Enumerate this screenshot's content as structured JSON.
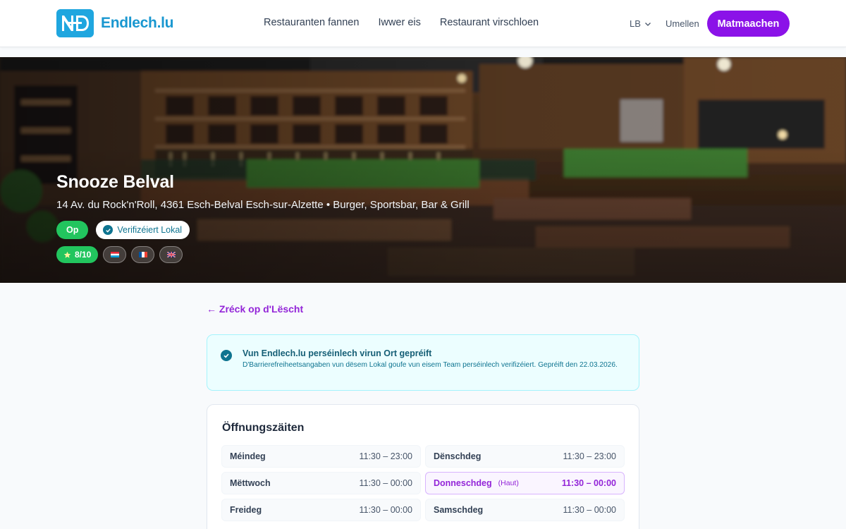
{
  "header": {
    "brand": "Endlech.lu",
    "nav": [
      "Restauranten fannen",
      "Iwwer eis",
      "Restaurant virschloen"
    ],
    "language": "LB",
    "login": "Umellen",
    "cta": "Matmaachen"
  },
  "hero": {
    "name": "Snooze Belval",
    "address": "14 Av. du Rock'n'Roll, 4361 Esch-Belval Esch-sur-Alzette",
    "categories": "Burger, Sportsbar, Bar & Grill",
    "status": "Op",
    "verified": "Verifizéiert Lokal",
    "rating": "8/10",
    "languages_shown": [
      "lb-flag-icon",
      "fr-flag-icon",
      "gb-flag-icon"
    ]
  },
  "back_link": "← Zréck op d'Lëscht",
  "notice": {
    "title": "Vun Endlech.lu perséinlech virun Ort gepréift",
    "text": "D'Barrierefreiheetsangaben vun dësem Lokal goufe vun eisem Team perséinlech verifizéiert. Gepréift den 22.03.2026."
  },
  "hours": {
    "title": "Öffnungszäiten",
    "days": [
      {
        "day": "Méindeg",
        "time": "11:30 – 23:00"
      },
      {
        "day": "Dënschdeg",
        "time": "11:30 – 23:00"
      },
      {
        "day": "Mëttwoch",
        "time": "11:30 – 00:00"
      },
      {
        "day": "Donneschdeg",
        "note": "(Haut)",
        "time": "11:30 – 00:00"
      },
      {
        "day": "Freideg",
        "time": "11:30 – 00:00"
      },
      {
        "day": "Samschdeg",
        "time": "11:30 – 00:00"
      }
    ]
  },
  "colors": {
    "brand_blue": "#1fa6df",
    "accent_purple": "#8b12e8",
    "open_green": "#22c55e",
    "verified_teal": "#0e7490"
  }
}
